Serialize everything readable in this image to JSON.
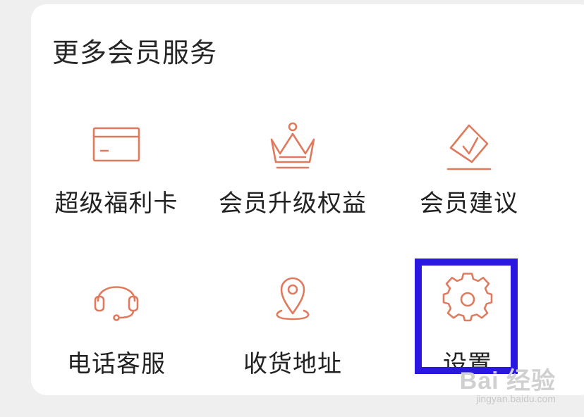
{
  "section": {
    "title": "更多会员服务"
  },
  "items": [
    {
      "label": "超级福利卡",
      "icon": "card-icon"
    },
    {
      "label": "会员升级权益",
      "icon": "crown-icon"
    },
    {
      "label": "会员建议",
      "icon": "suggestion-icon"
    },
    {
      "label": "电话客服",
      "icon": "headset-icon"
    },
    {
      "label": "收货地址",
      "icon": "location-pin-icon"
    },
    {
      "label": "设置",
      "icon": "gear-icon"
    }
  ],
  "highlight": {
    "target": "设置",
    "color": "#2a17e0"
  },
  "watermark": {
    "brand": "Bai 经验",
    "url": "jingyan.baidu.com"
  },
  "colors": {
    "icon_stroke": "#e07a5f",
    "text": "#222222",
    "card_bg": "#ffffff",
    "page_bg": "#efefef"
  }
}
